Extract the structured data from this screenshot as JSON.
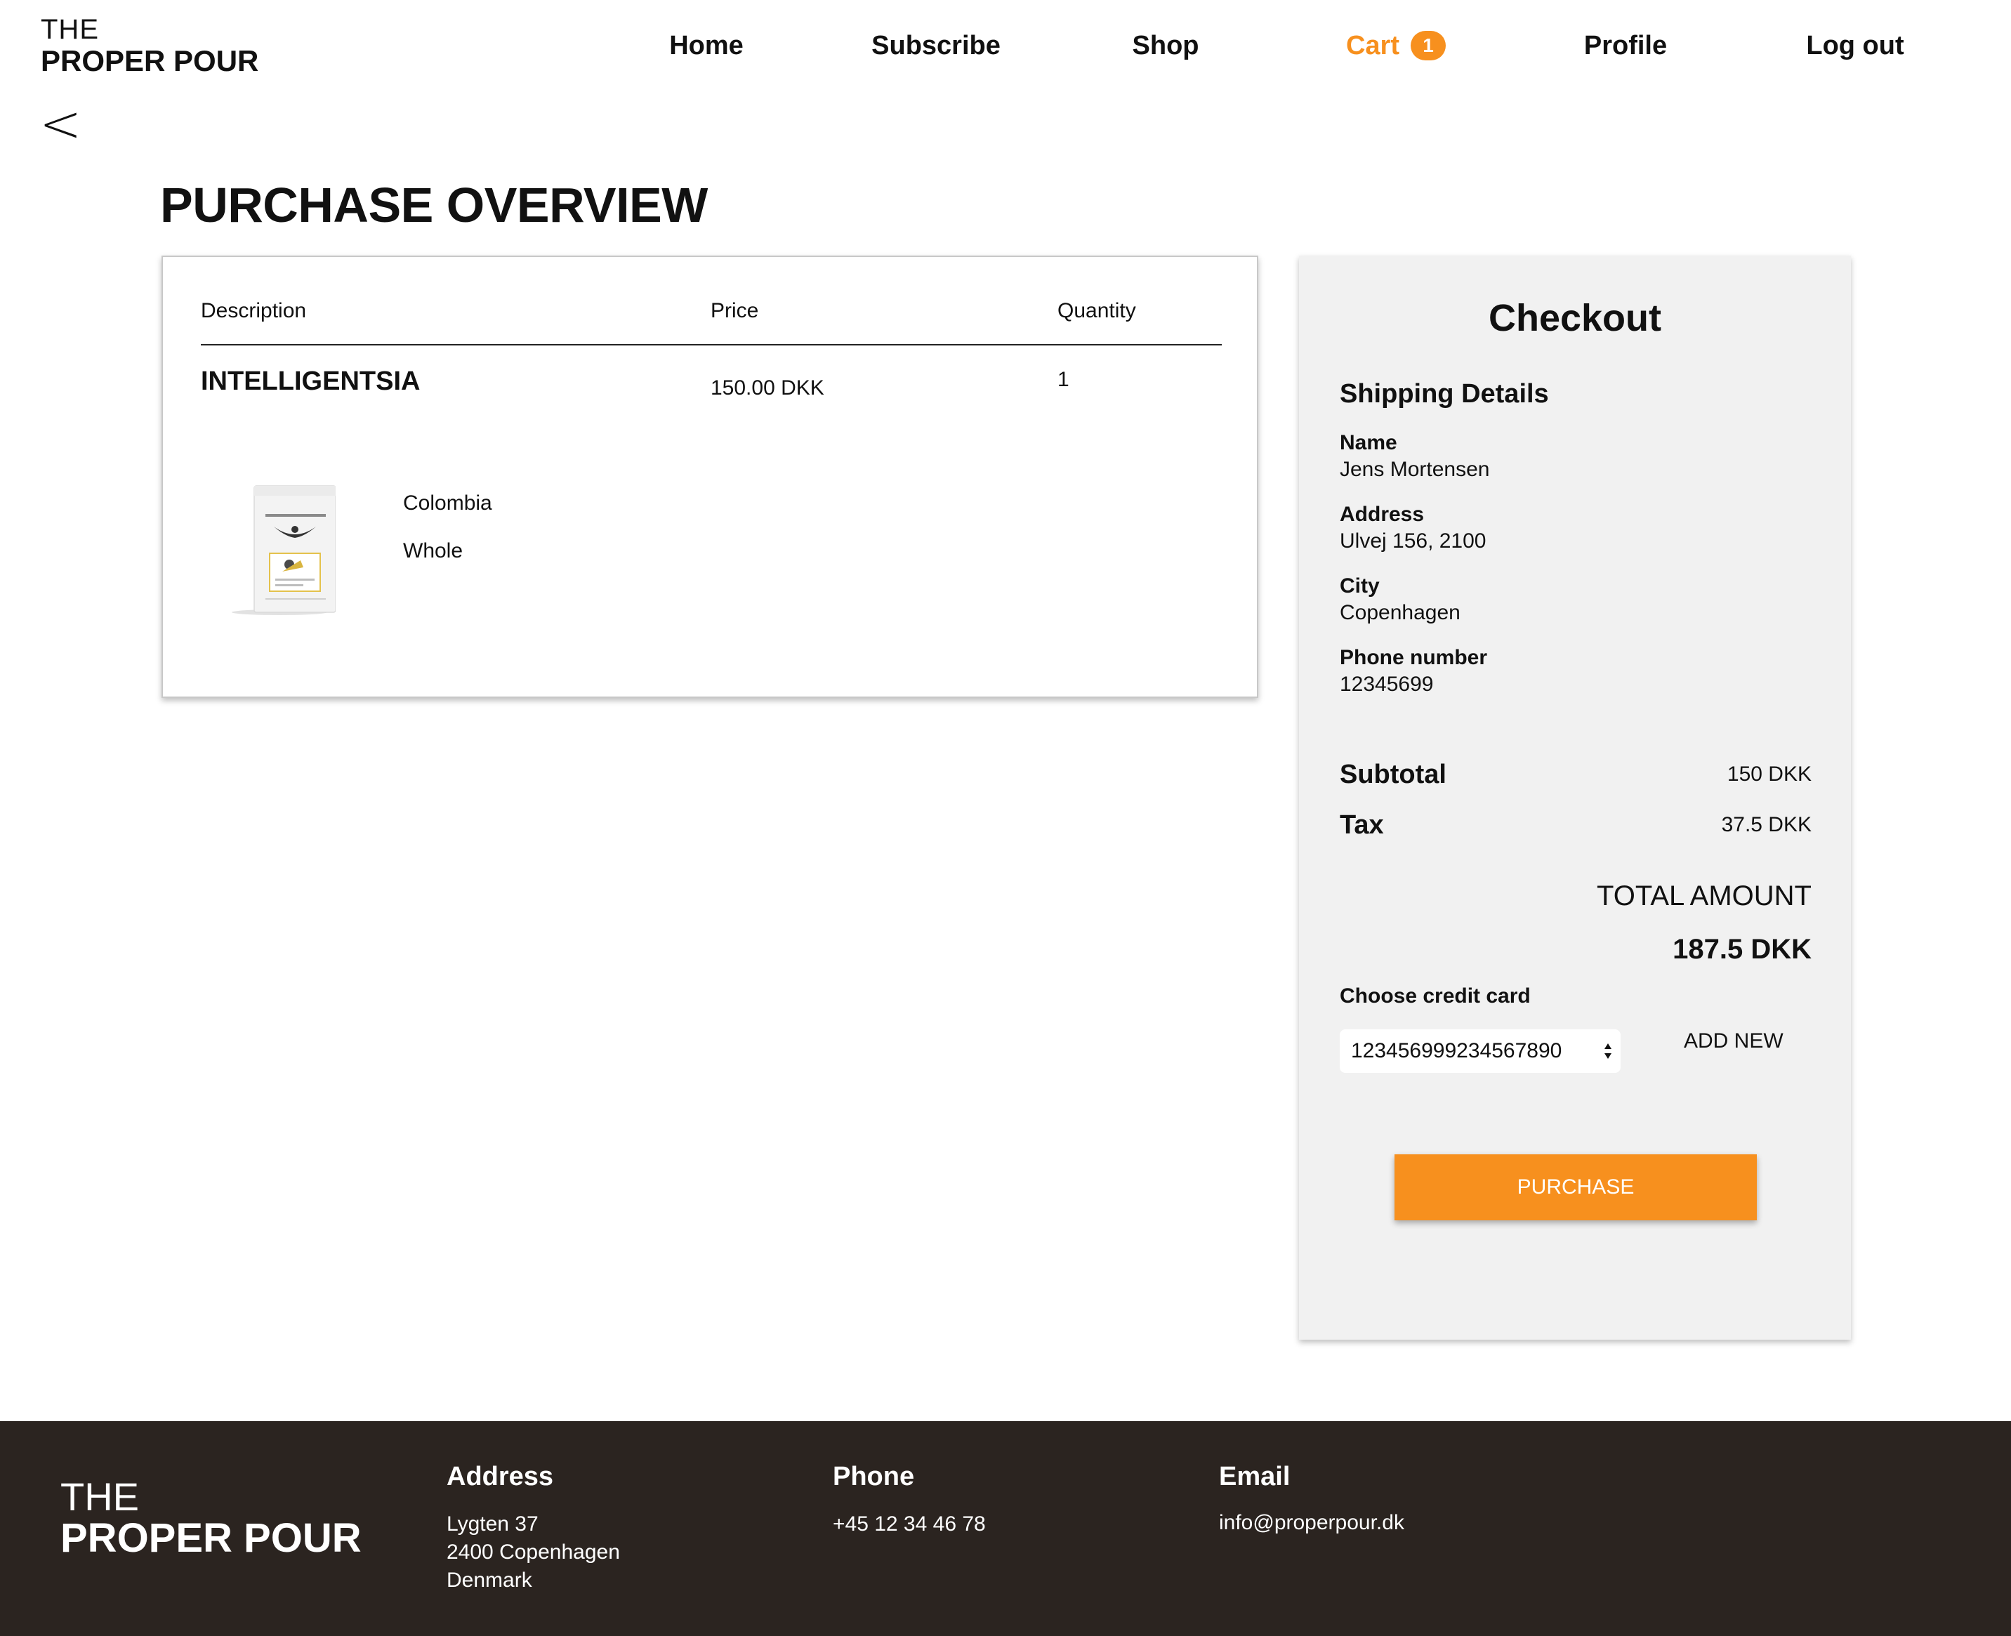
{
  "header": {
    "logo_line1": "THE",
    "logo_line2": "PROPER POUR",
    "nav": {
      "home": "Home",
      "subscribe": "Subscribe",
      "shop": "Shop",
      "cart": "Cart",
      "cart_count": "1",
      "profile": "Profile",
      "logout": "Log out"
    },
    "accent_color": "#f7901e",
    "back_glyph": "<"
  },
  "page": {
    "title": "PURCHASE OVERVIEW"
  },
  "overview": {
    "columns": [
      "Description",
      "Price",
      "Quantity"
    ],
    "items": [
      {
        "name": "INTELLIGENTSIA",
        "price": "150.00 DKK",
        "quantity": "1",
        "origin": "Colombia",
        "grind": "Whole"
      }
    ]
  },
  "checkout": {
    "title": "Checkout",
    "shipping_title": "Shipping Details",
    "fields": [
      {
        "label": "Name",
        "value": "Jens Mortensen"
      },
      {
        "label": "Address",
        "value": "Ulvej 156, 2100"
      },
      {
        "label": "City",
        "value": "Copenhagen"
      },
      {
        "label": "Phone number",
        "value": "12345699"
      }
    ],
    "subtotal_label": "Subtotal",
    "subtotal_value": "150 DKK",
    "tax_label": "Tax",
    "tax_value": "37.5 DKK",
    "total_label": "TOTAL AMOUNT",
    "total_value": "187.5 DKK",
    "credit_card_label": "Choose credit card",
    "credit_card_selected": "123456999234567890",
    "add_new_label": "ADD NEW",
    "purchase_label": "PURCHASE"
  },
  "footer": {
    "logo_line1": "THE",
    "logo_line2": "PROPER POUR",
    "address_title": "Address",
    "address_lines": [
      "Lygten 37",
      "2400 Copenhagen",
      "Denmark"
    ],
    "phone_title": "Phone",
    "phone": "+45 12 34 46 78",
    "email_title": "Email",
    "email": "info@properpour.dk",
    "background_color": "#2b2420"
  }
}
